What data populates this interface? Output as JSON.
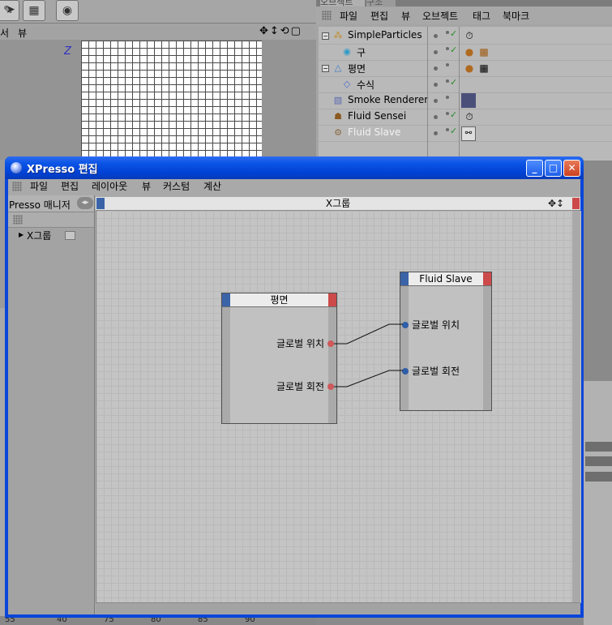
{
  "background_app": {
    "viewport_menu": {
      "item_left": "서",
      "item_view": "뷰"
    },
    "viewport_axis": "Z",
    "ruler_ticks": [
      "55",
      "40",
      "75",
      "80",
      "85",
      "90"
    ],
    "object_manager": {
      "tab_objects": "오브젝트",
      "tab_structure": "구조",
      "menu": [
        "파일",
        "편집",
        "뷰",
        "오브젝트",
        "태그",
        "북마크"
      ],
      "objects": [
        {
          "name": "SimpleParticles",
          "icon": "particles-icon"
        },
        {
          "name": "구",
          "icon": "sphere-icon"
        },
        {
          "name": "평면",
          "icon": "plane-icon"
        },
        {
          "name": "수식",
          "icon": "formula-icon"
        },
        {
          "name": "Smoke Renderer",
          "icon": "smoke-icon"
        },
        {
          "name": "Fluid Sensei",
          "icon": "sensei-icon"
        },
        {
          "name": "Fluid Slave",
          "icon": "slave-icon",
          "greyed": true
        }
      ]
    }
  },
  "xpresso": {
    "window_title": "XPresso 편집",
    "menu": [
      "파일",
      "편집",
      "레이아웃",
      "뷰",
      "커스텀",
      "계산"
    ],
    "left_panel": {
      "tab_label": "Presso 매니저",
      "items": [
        {
          "label": "X그룹"
        }
      ]
    },
    "graph": {
      "group_title": "X그룹",
      "nodes": [
        {
          "title": "평면",
          "outputs": [
            "글로벌 위치",
            "글로벌 회전"
          ]
        },
        {
          "title": "Fluid Slave",
          "inputs": [
            "글로벌 위치",
            "글로벌 회전"
          ]
        }
      ],
      "connections": [
        {
          "from": "평면.글로벌 위치",
          "to": "Fluid Slave.글로벌 위치"
        },
        {
          "from": "평면.글로벌 회전",
          "to": "Fluid Slave.글로벌 회전"
        }
      ]
    }
  },
  "colors": {
    "titlebar": "#0b54e6",
    "port_input": "#2f5ea8",
    "port_output": "#d0585a",
    "node_header_left": "#3b64a8",
    "node_header_right": "#cc4a4a"
  }
}
